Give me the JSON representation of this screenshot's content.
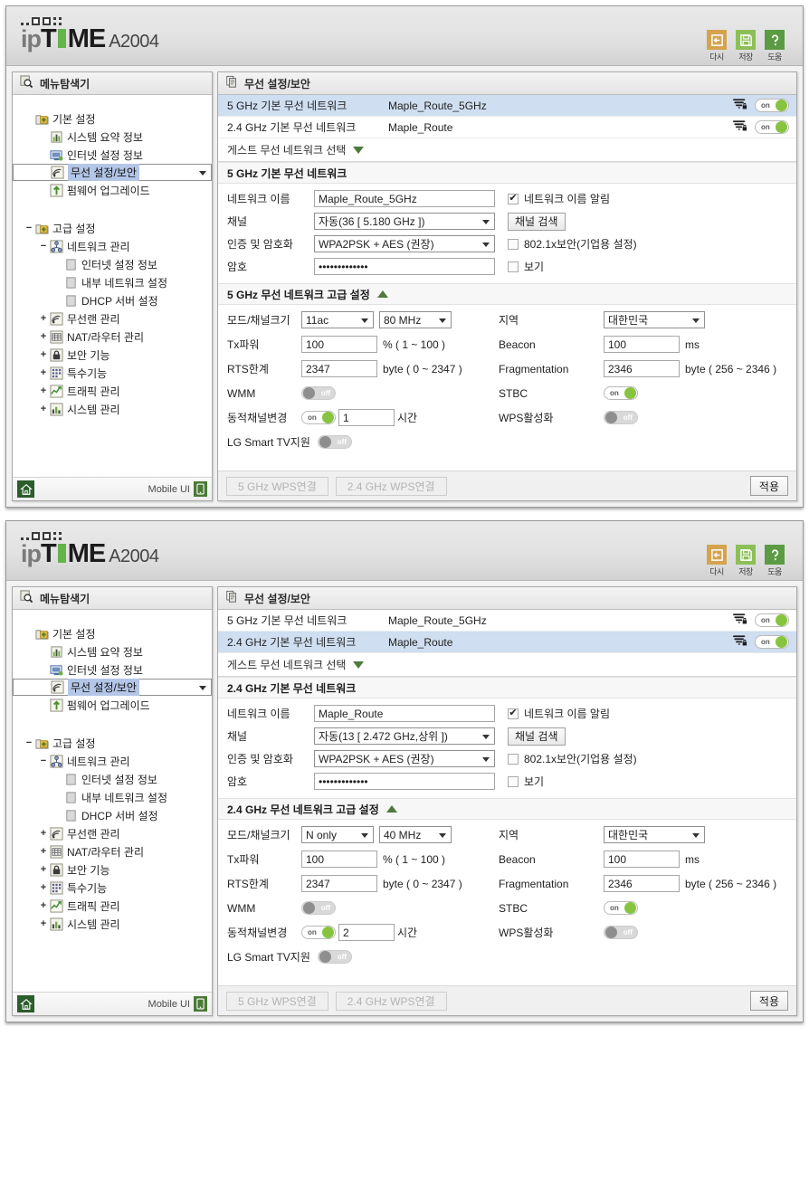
{
  "brand": {
    "ip": "ip",
    "t": "T",
    "me": "ME",
    "model": "A2004"
  },
  "header_icons": [
    {
      "name": "reset-icon",
      "label": "다시",
      "color": "#d5a34e"
    },
    {
      "name": "save-icon",
      "label": "저장",
      "color": "#8cbf56"
    },
    {
      "name": "help-icon",
      "label": "도움",
      "color": "#5b9b43"
    }
  ],
  "sidebar": {
    "title": "메뉴탐색기",
    "home_label": "home",
    "mobile_ui_label": "Mobile UI",
    "tree": [
      {
        "level": 1,
        "expander": "",
        "icon": "folder-plus-icon",
        "label": "기본 설정",
        "selected": false
      },
      {
        "level": 2,
        "expander": "",
        "icon": "chart-icon",
        "label": "시스템 요약 정보",
        "selected": false
      },
      {
        "level": 2,
        "expander": "",
        "icon": "monitor-icon",
        "label": "인터넷 설정 정보",
        "selected": false
      },
      {
        "level": 2,
        "expander": "",
        "icon": "wifi-icon",
        "label": "무선 설정/보안",
        "selected": true
      },
      {
        "level": 2,
        "expander": "",
        "icon": "upload-icon",
        "label": "펌웨어 업그레이드",
        "selected": false
      },
      {
        "level": 1,
        "expander": "−",
        "icon": "folder-plus-icon",
        "label": "고급 설정",
        "selected": false,
        "gap_before": true
      },
      {
        "level": 2,
        "expander": "−",
        "icon": "network-icon",
        "label": "네트워크 관리",
        "selected": false
      },
      {
        "level": 3,
        "expander": "",
        "icon": "page-icon",
        "label": "인터넷 설정 정보",
        "selected": false
      },
      {
        "level": 3,
        "expander": "",
        "icon": "page-icon",
        "label": "내부 네트워크 설정",
        "selected": false
      },
      {
        "level": 3,
        "expander": "",
        "icon": "page-icon",
        "label": "DHCP 서버 설정",
        "selected": false
      },
      {
        "level": 2,
        "expander": "+",
        "icon": "wifi-icon",
        "label": "무선랜 관리",
        "selected": false
      },
      {
        "level": 2,
        "expander": "+",
        "icon": "grid-icon",
        "label": "NAT/라우터 관리",
        "selected": false
      },
      {
        "level": 2,
        "expander": "+",
        "icon": "lock-icon",
        "label": "보안 기능",
        "selected": false
      },
      {
        "level": 2,
        "expander": "+",
        "icon": "special-icon",
        "label": "특수기능",
        "selected": false
      },
      {
        "level": 2,
        "expander": "+",
        "icon": "traffic-icon",
        "label": "트래픽 관리",
        "selected": false
      },
      {
        "level": 2,
        "expander": "+",
        "icon": "system-icon",
        "label": "시스템 관리",
        "selected": false
      }
    ]
  },
  "panels": [
    {
      "content_title": "무선 설정/보안",
      "networks": [
        {
          "name": "5 GHz 기본 무선 네트워크",
          "ssid": "Maple_Route_5GHz",
          "toggle": "on",
          "active": true
        },
        {
          "name": "2.4 GHz 기본 무선 네트워크",
          "ssid": "Maple_Route",
          "toggle": "on",
          "active": false
        }
      ],
      "guest_label": "게스트 무선 네트워크 선택",
      "basic_section_title": "5 GHz 기본 무선 네트워크",
      "fields": {
        "ssid_label": "네트워크 이름",
        "ssid_value": "Maple_Route_5GHz",
        "ssid_broadcast_label": "네트워크 이름 알림",
        "ssid_broadcast_checked": true,
        "channel_label": "채널",
        "channel_value": "자동(36 [ 5.180 GHz ])",
        "channel_scan_button": "채널 검색",
        "auth_label": "인증 및 암호화",
        "auth_value": "WPA2PSK + AES (권장)",
        "enterprise_label": "802.1x보안(기업용 설정)",
        "enterprise_checked": false,
        "password_label": "암호",
        "password_value": "•••••••••••••",
        "show_password_label": "보기",
        "show_password_checked": false
      },
      "adv_section_title": "5 GHz 무선 네트워크 고급 설정",
      "adv": {
        "mode_label": "모드/채널크기",
        "mode_value": "11ac",
        "bandwidth_value": "80 MHz",
        "region_label": "지역",
        "region_value": "대한민국",
        "txpower_label": "Tx파워",
        "txpower_value": "100",
        "txpower_unit": "% ( 1 ~ 100 )",
        "beacon_label": "Beacon",
        "beacon_value": "100",
        "beacon_unit": "ms",
        "rts_label": "RTS한계",
        "rts_value": "2347",
        "rts_unit": "byte ( 0 ~ 2347 )",
        "frag_label": "Fragmentation",
        "frag_value": "2346",
        "frag_unit": "byte ( 256 ~ 2346 )",
        "wmm_label": "WMM",
        "wmm_toggle": "off",
        "stbc_label": "STBC",
        "stbc_toggle": "on",
        "dyn_label": "동적채널변경",
        "dyn_toggle": "on",
        "dyn_value": "1",
        "dyn_unit": "시간",
        "wps_label": "WPS활성화",
        "wps_toggle": "off",
        "lgtv_label": "LG Smart TV지원",
        "lgtv_toggle": "off"
      },
      "footer": {
        "wps5_label": "5 GHz WPS연결",
        "wps24_label": "2.4 GHz WPS연결",
        "apply_label": "적용"
      }
    },
    {
      "content_title": "무선 설정/보안",
      "networks": [
        {
          "name": "5 GHz 기본 무선 네트워크",
          "ssid": "Maple_Route_5GHz",
          "toggle": "on",
          "active": false
        },
        {
          "name": "2.4 GHz 기본 무선 네트워크",
          "ssid": "Maple_Route",
          "toggle": "on",
          "active": true
        }
      ],
      "guest_label": "게스트 무선 네트워크 선택",
      "basic_section_title": "2.4 GHz 기본 무선 네트워크",
      "fields": {
        "ssid_label": "네트워크 이름",
        "ssid_value": "Maple_Route",
        "ssid_broadcast_label": "네트워크 이름 알림",
        "ssid_broadcast_checked": true,
        "channel_label": "채널",
        "channel_value": "자동(13 [ 2.472 GHz,상위 ])",
        "channel_scan_button": "채널 검색",
        "auth_label": "인증 및 암호화",
        "auth_value": "WPA2PSK + AES (권장)",
        "enterprise_label": "802.1x보안(기업용 설정)",
        "enterprise_checked": false,
        "password_label": "암호",
        "password_value": "•••••••••••••",
        "show_password_label": "보기",
        "show_password_checked": false
      },
      "adv_section_title": "2.4 GHz 무선 네트워크 고급 설정",
      "adv": {
        "mode_label": "모드/채널크기",
        "mode_value": "N only",
        "bandwidth_value": "40 MHz",
        "region_label": "지역",
        "region_value": "대한민국",
        "txpower_label": "Tx파워",
        "txpower_value": "100",
        "txpower_unit": "% ( 1 ~ 100 )",
        "beacon_label": "Beacon",
        "beacon_value": "100",
        "beacon_unit": "ms",
        "rts_label": "RTS한계",
        "rts_value": "2347",
        "rts_unit": "byte ( 0 ~ 2347 )",
        "frag_label": "Fragmentation",
        "frag_value": "2346",
        "frag_unit": "byte ( 256 ~ 2346 )",
        "wmm_label": "WMM",
        "wmm_toggle": "off",
        "stbc_label": "STBC",
        "stbc_toggle": "on",
        "dyn_label": "동적채널변경",
        "dyn_toggle": "on",
        "dyn_value": "2",
        "dyn_unit": "시간",
        "wps_label": "WPS활성화",
        "wps_toggle": "off",
        "lgtv_label": "LG Smart TV지원",
        "lgtv_toggle": "off"
      },
      "footer": {
        "wps5_label": "5 GHz WPS연결",
        "wps24_label": "2.4 GHz WPS연결",
        "apply_label": "적용"
      }
    }
  ],
  "toggle_text": {
    "on": "on",
    "off": "off"
  }
}
